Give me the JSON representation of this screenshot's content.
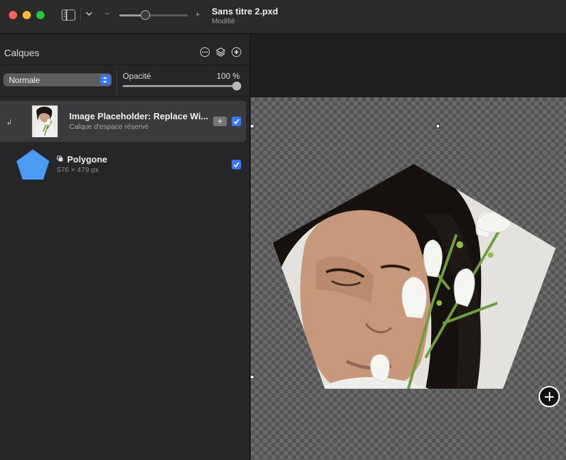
{
  "window": {
    "title": "Sans titre 2.pxd",
    "subtitle": "Modifié",
    "zoom_minus": "−",
    "zoom_plus": "+",
    "zoom_level_fraction": 0.38
  },
  "layers_panel": {
    "title": "Calques",
    "blend_mode": "Normale",
    "opacity_label": "Opacité",
    "opacity_value": "100 %",
    "opacity_fraction": 1.0,
    "layers": [
      {
        "name": "Image Placeholder: Replace Wi...",
        "subtitle": "Calque d'espace réservé",
        "add_label": "+",
        "visible": true,
        "selected": true
      },
      {
        "name": "Polygone",
        "subtitle": "576 × 479 px",
        "visible": true,
        "selected": false,
        "shape_color": "#4a9bf2"
      }
    ]
  },
  "colors": {
    "accent": "#3478f6",
    "titlebar": "#2a2a2b",
    "panel": "#262628",
    "close": "#ff5f57",
    "minimize": "#febc2e",
    "maximize": "#28c840"
  }
}
